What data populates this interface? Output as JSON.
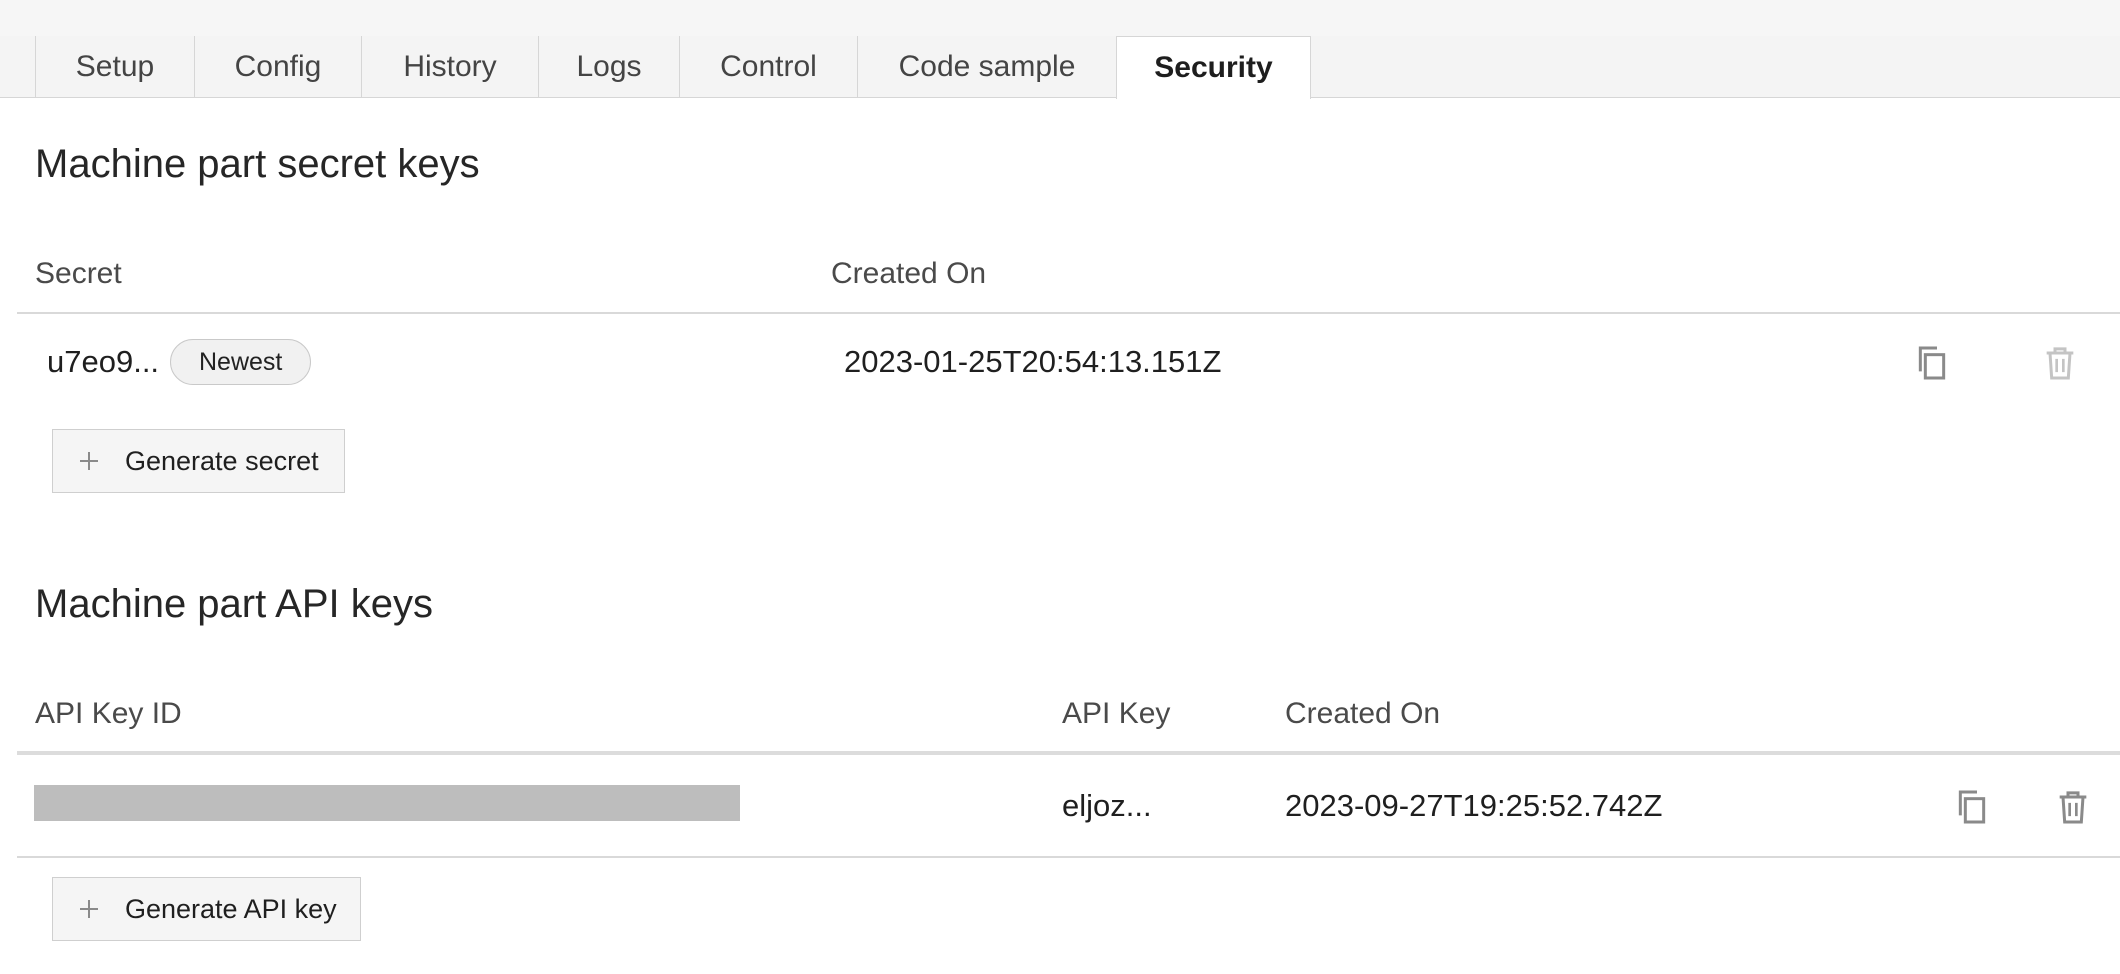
{
  "tabs": [
    {
      "label": "Setup"
    },
    {
      "label": "Config"
    },
    {
      "label": "History"
    },
    {
      "label": "Logs"
    },
    {
      "label": "Control"
    },
    {
      "label": "Code sample"
    },
    {
      "label": "Security"
    }
  ],
  "active_tab": "Security",
  "secrets": {
    "title": "Machine part secret keys",
    "columns": {
      "secret": "Secret",
      "created_on": "Created On"
    },
    "rows": [
      {
        "secret": "u7eo9...",
        "badge": "Newest",
        "created_on": "2023-01-25T20:54:13.151Z"
      }
    ],
    "generate_label": "Generate secret"
  },
  "api_keys": {
    "title": "Machine part API keys",
    "columns": {
      "api_key_id": "API Key ID",
      "api_key": "API Key",
      "created_on": "Created On"
    },
    "rows": [
      {
        "api_key_id": "",
        "api_key": "eljoz...",
        "created_on": "2023-09-27T19:25:52.742Z"
      }
    ],
    "generate_label": "Generate API key"
  },
  "icons": {
    "plus": "plus-icon",
    "copy": "copy-icon",
    "trash": "trash-icon"
  },
  "colors": {
    "tab_bar": "#f4f4f4",
    "redaction": "#bdbdbd",
    "disabled_icon": "#c4c4c4",
    "icon": "#8a8a8a"
  }
}
